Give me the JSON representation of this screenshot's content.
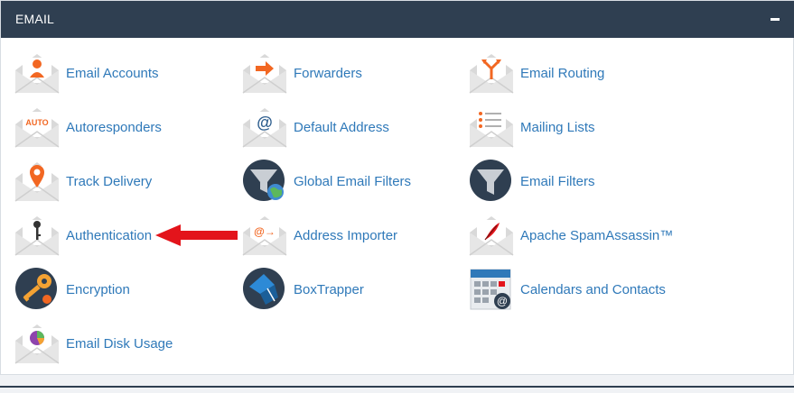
{
  "section": {
    "title": "EMAIL",
    "collapse_symbol": "−"
  },
  "items": [
    {
      "label": "Email Accounts",
      "icon": "email-accounts-icon"
    },
    {
      "label": "Forwarders",
      "icon": "forwarders-icon"
    },
    {
      "label": "Email Routing",
      "icon": "email-routing-icon"
    },
    {
      "label": "Autoresponders",
      "icon": "autoresponders-icon",
      "icon_text": "AUTO"
    },
    {
      "label": "Default Address",
      "icon": "default-address-icon",
      "icon_text": "@"
    },
    {
      "label": "Mailing Lists",
      "icon": "mailing-lists-icon"
    },
    {
      "label": "Track Delivery",
      "icon": "track-delivery-icon"
    },
    {
      "label": "Global Email Filters",
      "icon": "global-email-filters-icon"
    },
    {
      "label": "Email Filters",
      "icon": "email-filters-icon"
    },
    {
      "label": "Authentication",
      "icon": "authentication-icon"
    },
    {
      "label": "Address Importer",
      "icon": "address-importer-icon",
      "icon_text": "@→"
    },
    {
      "label": "Apache SpamAssassin™",
      "icon": "spamassassin-icon"
    },
    {
      "label": "Encryption",
      "icon": "encryption-icon"
    },
    {
      "label": "BoxTrapper",
      "icon": "boxtrapper-icon"
    },
    {
      "label": "Calendars and Contacts",
      "icon": "calendars-contacts-icon"
    },
    {
      "label": "Email Disk Usage",
      "icon": "email-disk-usage-icon"
    }
  ],
  "colors": {
    "header_bg": "#2f3f51",
    "link": "#2f79b9",
    "accent_orange": "#f26722",
    "envelope": "#dcdcdc",
    "dark_circle": "#2f3f51",
    "arrow": "#e3141b"
  },
  "annotation": {
    "type": "red-arrow",
    "points_to": "Authentication"
  }
}
